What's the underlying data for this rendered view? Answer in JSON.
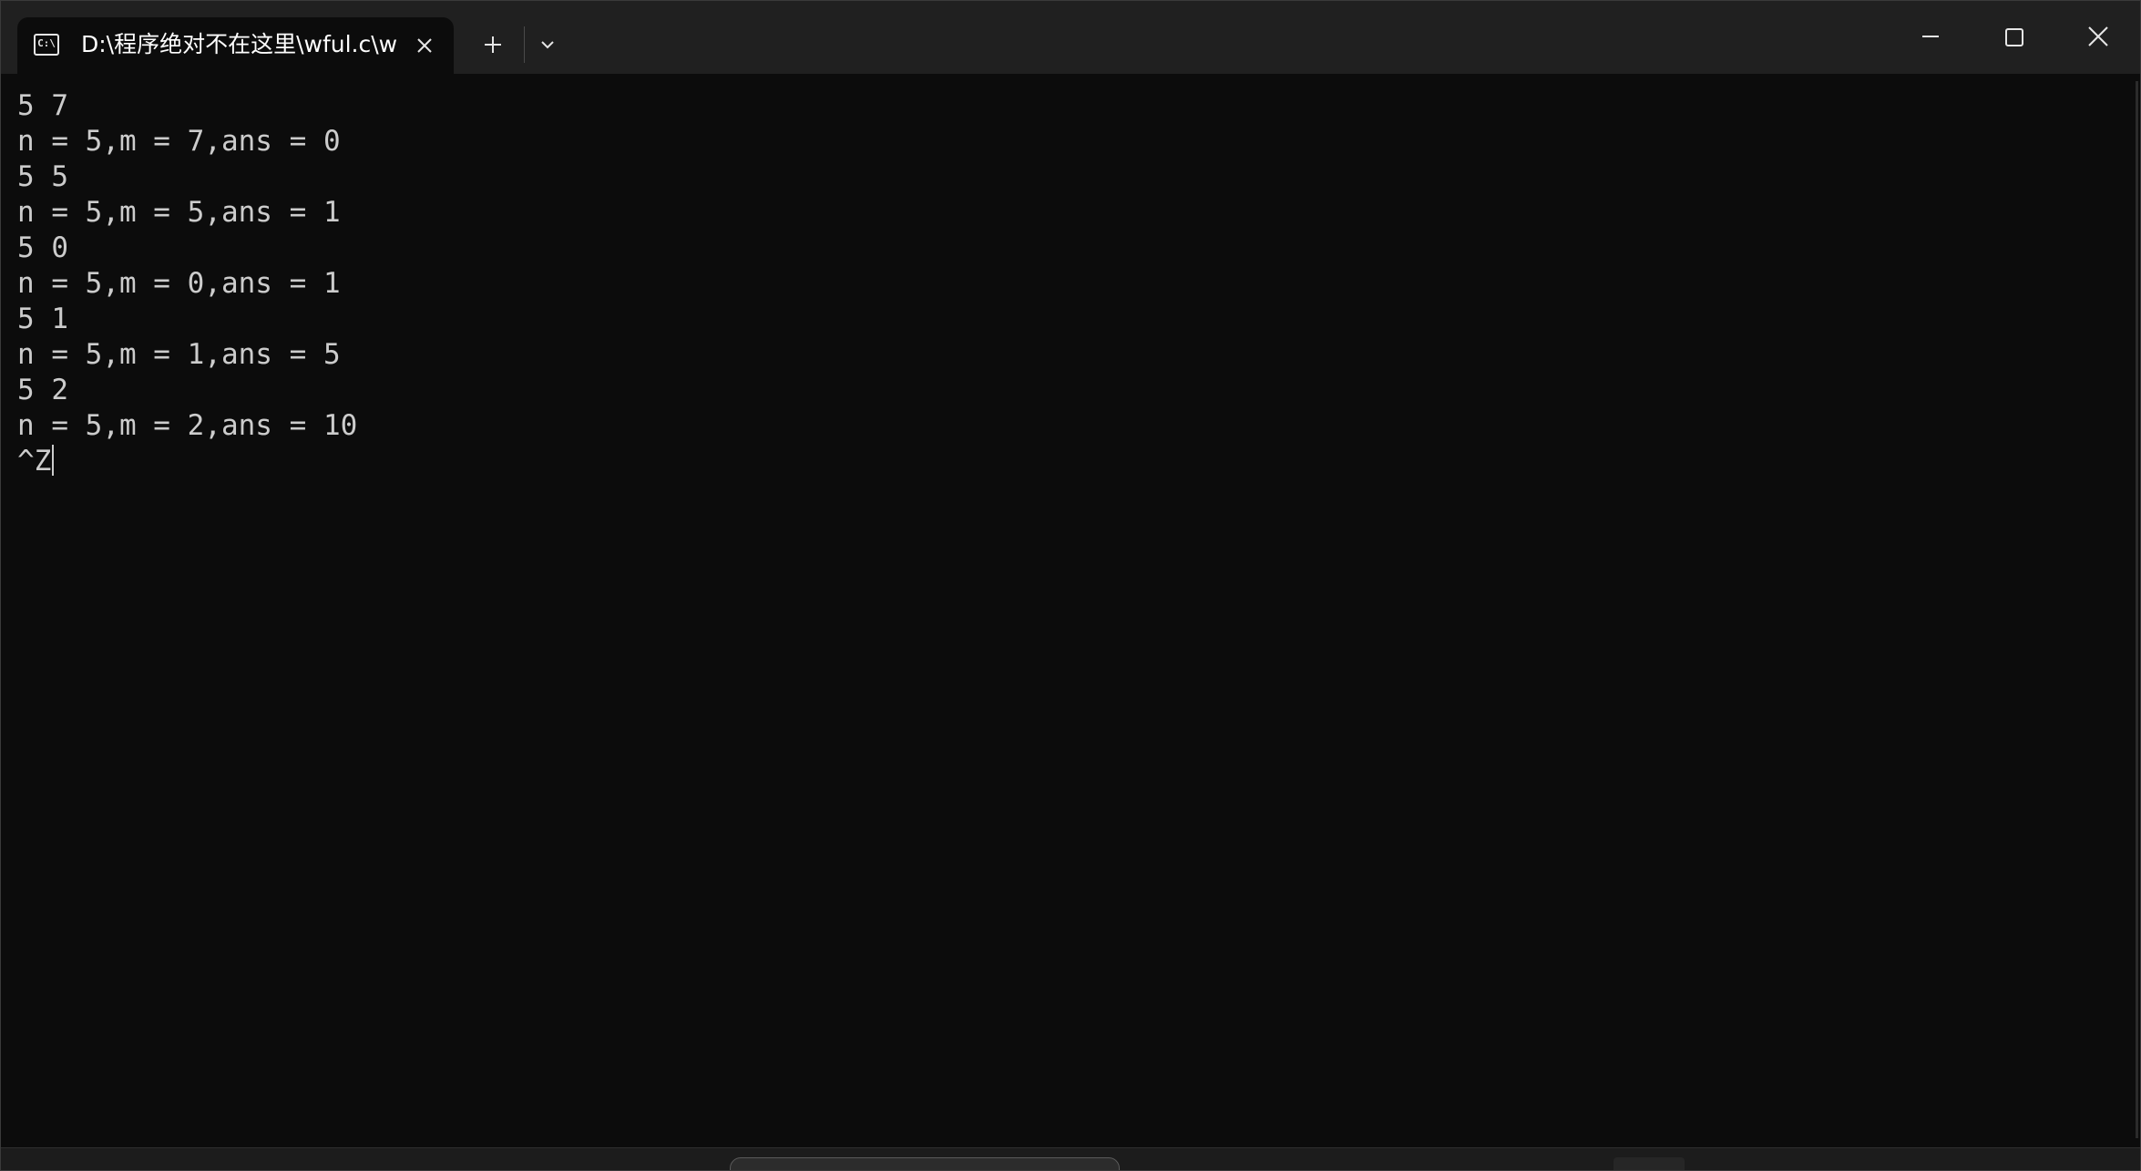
{
  "window": {
    "tab_title": "D:\\程序绝对不在这里\\wful.c\\w",
    "tab_icon": "terminal-icon",
    "tab_icon_text": "C:\\",
    "new_tab_icon": "plus-icon",
    "dropdown_icon": "chevron-down-icon",
    "controls": [
      "minimize-icon",
      "maximize-icon",
      "close-icon"
    ]
  },
  "terminal": {
    "lines": [
      "5 7",
      "n = 5,m = 7,ans = 0",
      "5 5",
      "n = 5,m = 5,ans = 1",
      "5 0",
      "n = 5,m = 0,ans = 1",
      "5 1",
      "n = 5,m = 1,ans = 5",
      "5 2",
      "n = 5,m = 2,ans = 10"
    ],
    "prompt_line": "^Z",
    "text_color": "#cccccc",
    "background": "#0c0c0c"
  }
}
